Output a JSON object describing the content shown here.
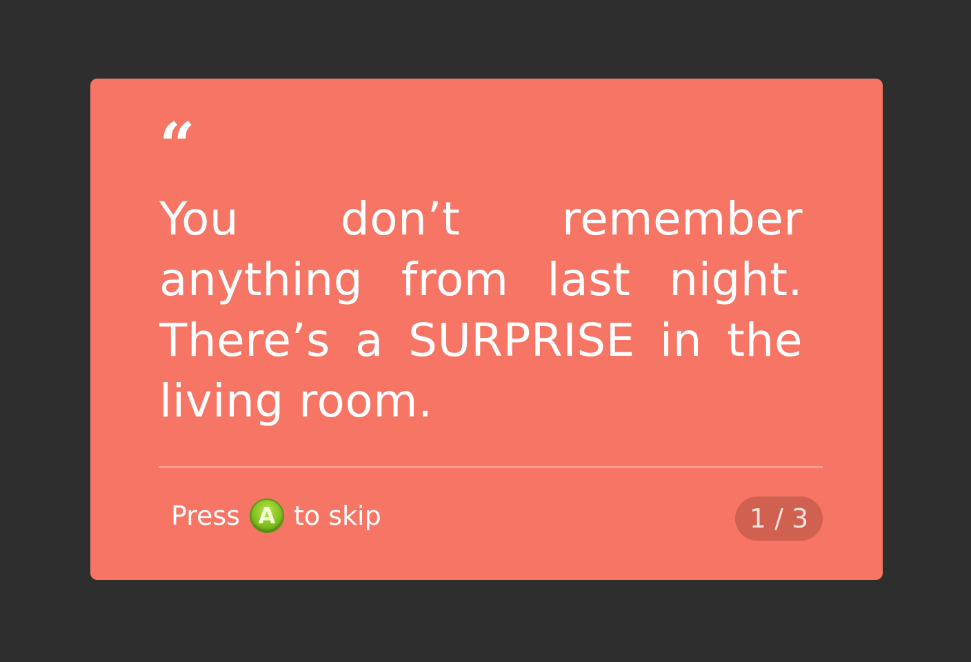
{
  "dialog": {
    "quote_mark": "“",
    "message": "You don’t remember anything from last night. There’s a SURPRISE in the living room."
  },
  "footer": {
    "press_label": "Press",
    "button_letter": "A",
    "skip_label": "to skip",
    "page_indicator": "1 / 3"
  },
  "colors": {
    "background": "#2e2e2e",
    "card": "#f67564",
    "badge": "#d0604f",
    "a_button": "#7cbc1e"
  },
  "icons": {
    "skip_button": "a-button-icon"
  }
}
